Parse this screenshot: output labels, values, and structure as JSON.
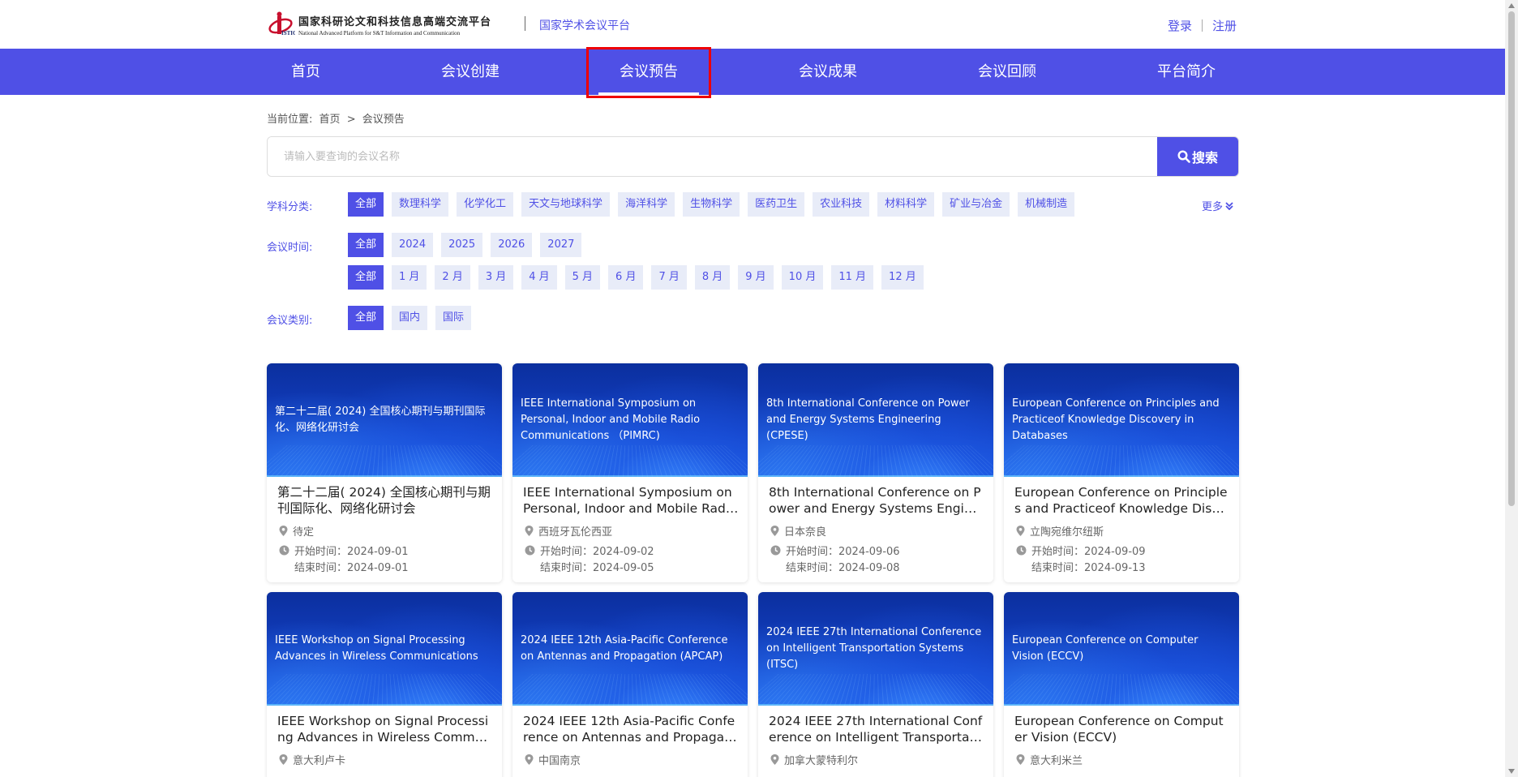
{
  "header": {
    "logo_cn": "国家科研论文和科技信息高端交流平台",
    "logo_en": "National Advanced Platform for S&T Information and Communication",
    "logo_mark": "ISTIC",
    "platform_name": "国家学术会议平台",
    "login": "登录",
    "register": "注册"
  },
  "nav": {
    "items": [
      {
        "label": "首页"
      },
      {
        "label": "会议创建"
      },
      {
        "label": "会议预告"
      },
      {
        "label": "会议成果"
      },
      {
        "label": "会议回顾"
      },
      {
        "label": "平台简介"
      }
    ],
    "active_index": 2
  },
  "breadcrumb": {
    "prefix": "当前位置:",
    "home": "首页",
    "separator": ">",
    "current": "会议预告"
  },
  "search": {
    "placeholder": "请输入要查询的会议名称",
    "button": "搜索"
  },
  "filters": {
    "subject": {
      "label": "学科分类:",
      "options": [
        "全部",
        "数理科学",
        "化学化工",
        "天文与地球科学",
        "海洋科学",
        "生物科学",
        "医药卫生",
        "农业科技",
        "材料科学",
        "矿业与冶金",
        "机械制造"
      ],
      "more": "更多"
    },
    "time": {
      "label": "会议时间:",
      "years": [
        "全部",
        "2024",
        "2025",
        "2026",
        "2027"
      ],
      "months": [
        "全部",
        "1 月",
        "2 月",
        "3 月",
        "4 月",
        "5 月",
        "6 月",
        "7 月",
        "8 月",
        "9 月",
        "10 月",
        "11 月",
        "12 月"
      ]
    },
    "category": {
      "label": "会议类别:",
      "options": [
        "全部",
        "国内",
        "国际"
      ]
    }
  },
  "cards": [
    {
      "banner": "第二十二届( 2024) 全国核心期刊与期刊国际化、网络化研讨会",
      "title": "第二十二届( 2024) 全国核心期刊与期刊国际化、网络化研讨会",
      "location": "待定",
      "start": "开始时间：2024-09-01",
      "end": "结束时间：2024-09-01"
    },
    {
      "banner": "IEEE International Symposium on Personal, Indoor and Mobile Radio Communications （PIMRC)",
      "title": "IEEE International Symposium on Personal, Indoor and Mobile Radio Communications （PIMRC)",
      "location": "西班牙瓦伦西亚",
      "start": "开始时间：2024-09-02",
      "end": "结束时间：2024-09-05"
    },
    {
      "banner": "8th International Conference on Power and Energy Systems Engineering (CPESE)",
      "title": "8th International Conference on Power and Energy Systems Engineering (CPESE)",
      "location": "日本奈良",
      "start": "开始时间：2024-09-06",
      "end": "结束时间：2024-09-08"
    },
    {
      "banner": "European Conference on Principles and Practiceof Knowledge Discovery in Databases",
      "title": "European Conference on Principles and Practiceof Knowledge Discovery in Databases",
      "location": "立陶宛维尔纽斯",
      "start": "开始时间：2024-09-09",
      "end": "结束时间：2024-09-13"
    },
    {
      "banner": "IEEE Workshop on Signal Processing Advances in Wireless Communications",
      "title": "IEEE Workshop on Signal Processing Advances in Wireless Communications",
      "location": "意大利卢卡",
      "start": "",
      "end": ""
    },
    {
      "banner": "2024 IEEE 12th Asia-Pacific Conference on Antennas and Propagation (APCAP)",
      "title": "2024 IEEE 12th Asia-Pacific Conference on Antennas and Propagation (APCAP)",
      "location": "中国南京",
      "start": "",
      "end": ""
    },
    {
      "banner": "2024 IEEE 27th International Conference on Intelligent Transportation Systems (ITSC)",
      "title": "2024 IEEE 27th International Conference on Intelligent Transportation Systems (ITSC)",
      "location": "加拿大蒙特利尔",
      "start": "",
      "end": ""
    },
    {
      "banner": "European Conference on Computer Vision (ECCV)",
      "title": "European Conference on Computer Vision (ECCV)",
      "location": "意大利米兰",
      "start": "",
      "end": ""
    }
  ],
  "colors": {
    "accent": "#4f50e6",
    "chip_bg": "#e8ecf8",
    "highlight_border": "#e00000"
  }
}
